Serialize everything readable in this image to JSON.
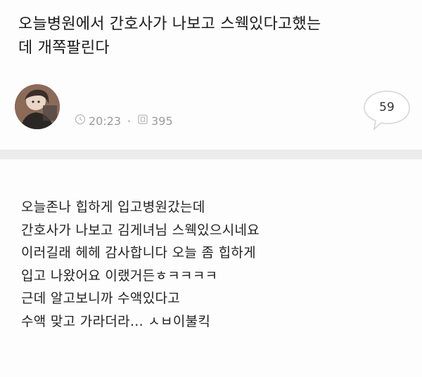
{
  "post": {
    "title": "오늘병원에서 간호사가 나보고 스웩있다고했는\n데 개쪽팔린다",
    "time": "20:23",
    "views": "395",
    "comment_count": "59",
    "body_lines": [
      "오늘존나 힙하게 입고병원갔는데",
      "간호사가 나보고 김게녀님 스웩있으시네요",
      "이러길래 헤헤 감사합니다 오늘 좀 힙하게",
      "입고 나왔어요 이랬거든ㅎㅋㅋㅋㅋ",
      "근데 알고보니까 수액있다고",
      "수액 맞고 가라더라... ㅅㅂ이불킥"
    ]
  },
  "icons": {
    "time": "clock-icon",
    "views": "view-count-icon",
    "comments": "comment-bubble-icon"
  },
  "colors": {
    "meta_text": "#9b9b9b",
    "divider": "#ececec",
    "text": "#1d1d1d"
  }
}
